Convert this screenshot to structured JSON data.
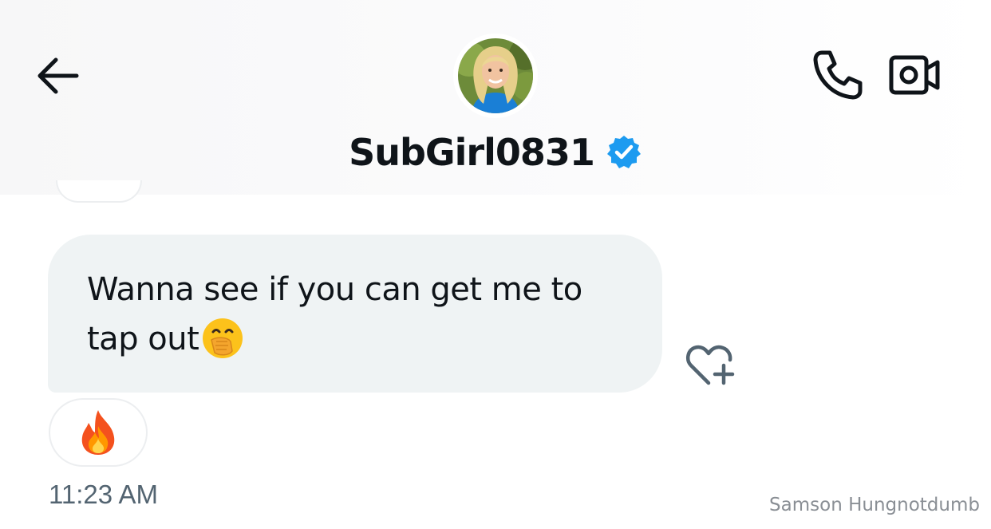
{
  "header": {
    "username": "SubGirl0831",
    "verified": true,
    "back_icon": "arrow-left-icon",
    "call_icon": "phone-icon",
    "video_icon": "video-camera-icon",
    "verified_color": "#1d9bf0"
  },
  "message": {
    "text": "Wanna see if you can get me to tap out",
    "emoji": "🤭",
    "reaction": "🔥",
    "timestamp": "11:23 AM",
    "bubble_color": "#eff3f4",
    "add_reaction_icon": "heart-plus-icon"
  },
  "watermark": "Samson Hungnotdumb"
}
